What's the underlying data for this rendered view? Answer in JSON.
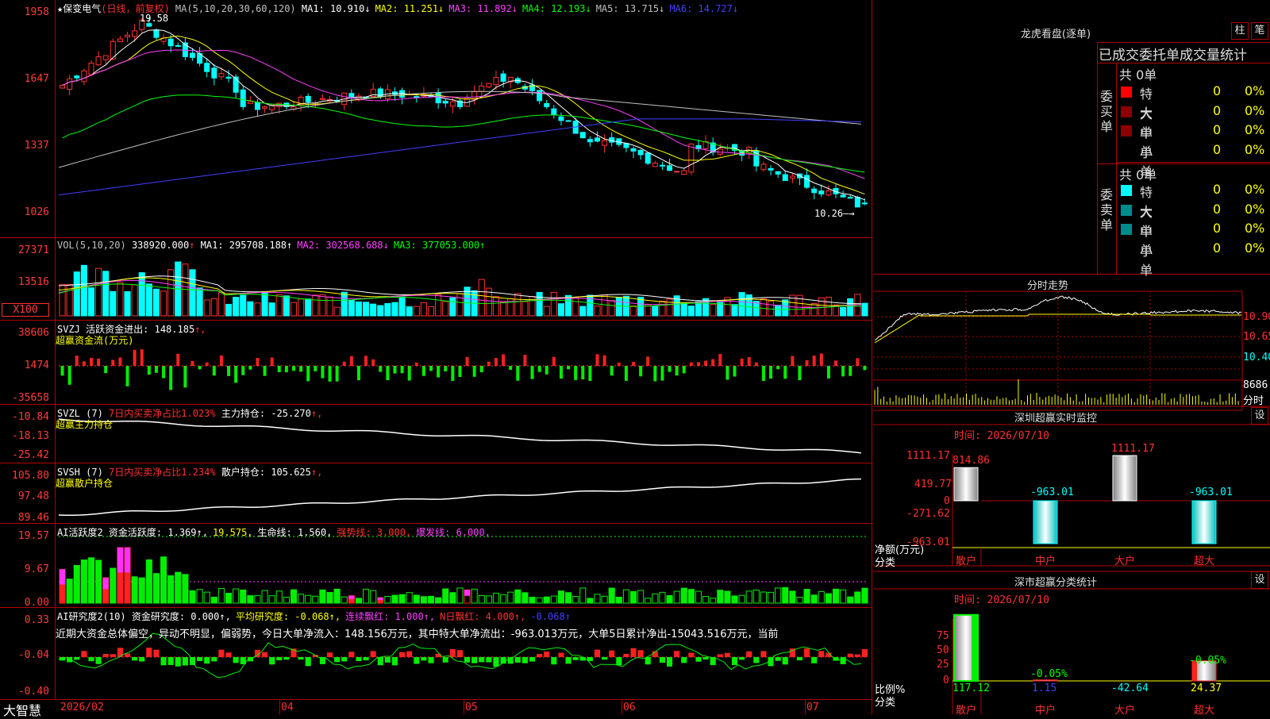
{
  "app": {
    "name": "大智慧"
  },
  "stock": {
    "name": "★保变电气",
    "mode": "(日线，前复权)",
    "high_label": "19.58",
    "last_label": "10.26"
  },
  "main_panel": {
    "ma_header": "MA(5,10,20,30,60,120)",
    "ma": [
      {
        "label": "MA1:",
        "value": "10.910",
        "arrow": "↓",
        "color": "#ffffff"
      },
      {
        "label": "MA2:",
        "value": "11.251",
        "arrow": "↓",
        "color": "#ffff00"
      },
      {
        "label": "MA3:",
        "value": "11.892",
        "arrow": "↓",
        "color": "#ff40ff"
      },
      {
        "label": "MA4:",
        "value": "12.193",
        "arrow": "↓",
        "color": "#00ff00"
      },
      {
        "label": "MA5:",
        "value": "13.715",
        "arrow": "↓",
        "color": "#c0c0c0"
      },
      {
        "label": "MA6:",
        "value": "14.727",
        "arrow": "↓",
        "color": "#4040ff"
      }
    ],
    "y_labels": [
      "1958",
      "1647",
      "1337",
      "1026"
    ]
  },
  "vol_panel": {
    "header": "VOL(5,10,20)",
    "value": "338920.000",
    "arrow": "↑",
    "ma": [
      {
        "label": "MA1:",
        "value": "295708.188",
        "arrow": "↑",
        "color": "#ffffff"
      },
      {
        "label": "MA2:",
        "value": "302568.688",
        "arrow": "↓",
        "color": "#ff40ff"
      },
      {
        "label": "MA3:",
        "value": "377053.000",
        "arrow": "↑",
        "color": "#00ff00"
      }
    ],
    "y_labels": [
      "27371",
      "13516",
      "X100"
    ]
  },
  "svzj_panel": {
    "header": "SVZJ",
    "label": "活跃资金进出:",
    "value": "148.185",
    "arrow": "↑,",
    "subtitle": "超赢资金流(万元)",
    "y_labels": [
      "38606",
      "1474",
      "-35658"
    ]
  },
  "svzl_panel": {
    "header": "SVZL (7)",
    "ratio": "7日内买卖净占比1.023%",
    "label": "主力持仓:",
    "value": "-25.270",
    "arrow": "↑,",
    "subtitle": "超赢主力持仓",
    "y_labels": [
      "-10.84",
      "-18.13",
      "-25.42"
    ]
  },
  "svsh_panel": {
    "header": "SVSH (7)",
    "ratio": "7日内买卖净占比1.234%",
    "label": "散户持仓:",
    "value": "105.625",
    "arrow": "↑,",
    "subtitle": "超赢散户持仓",
    "y_labels": [
      "105.80",
      "97.48",
      "89.46"
    ]
  },
  "ai1_panel": {
    "header": "AI活跃度2",
    "items": [
      {
        "text": "资金活跃度: 1.369",
        "arrow": "↑,",
        "color": "#ffffff"
      },
      {
        "text": "19.575,",
        "arrow": "",
        "color": "#ffff00"
      },
      {
        "text": "生命线: 1.560,",
        "arrow": "",
        "color": "#ffffff"
      },
      {
        "text": "强势线: 3.000,",
        "arrow": "",
        "color": "#ff3030"
      },
      {
        "text": "爆发线: 6.000,",
        "arrow": "",
        "color": "#ff40ff"
      }
    ],
    "y_labels": [
      "19.57",
      "9.67",
      "0.00"
    ]
  },
  "ai2_panel": {
    "header": "AI研究度2(10)",
    "items": [
      {
        "text": "资金研究度: 0.000",
        "arrow": "↑,",
        "color": "#ffffff"
      },
      {
        "text": "平均研究度: -0.068",
        "arrow": "↑,",
        "color": "#ffff00"
      },
      {
        "text": "连续飘红: 1.000",
        "arrow": "↑,",
        "color": "#ff40ff"
      },
      {
        "text": "N日飘红: 4.000",
        "arrow": "↑,",
        "color": "#ff3030"
      },
      {
        "text": "-0.068",
        "arrow": "↑",
        "color": "#4040ff"
      }
    ],
    "comment": "近期大资金总体偏空，异动不明显，偏弱势，今日大单净流入：148.156万元，其中特大单净流出：-963.013万元，大单5日累计净出-15043.516万元，当前",
    "y_labels": [
      "0.33",
      "-0.04",
      "-0.40"
    ]
  },
  "x_axis": {
    "labels": [
      "2026/02",
      "04",
      "05",
      "06",
      "07"
    ]
  },
  "dragon": {
    "title": "龙虎看盘(逐单)",
    "btn1": "柱",
    "btn2": "笔",
    "tabs": "已成交委托单成交量统计",
    "buy": {
      "side": "委买单",
      "total": "共 0单",
      "rows": [
        {
          "name": "特大",
          "count": "0",
          "pct": "0%"
        },
        {
          "name": "大单",
          "count": "0",
          "pct": "0%"
        },
        {
          "name": "中单",
          "count": "0",
          "pct": "0%"
        },
        {
          "name": "小单",
          "count": "0",
          "pct": "0%"
        }
      ]
    },
    "sell": {
      "side": "委卖单",
      "total": "共 0单",
      "rows": [
        {
          "name": "特大",
          "count": "0",
          "pct": "0%"
        },
        {
          "name": "大单",
          "count": "0",
          "pct": "0%"
        },
        {
          "name": "中单",
          "count": "0",
          "pct": "0%"
        },
        {
          "name": "小单",
          "count": "0",
          "pct": "0%"
        }
      ]
    }
  },
  "intraday": {
    "title": "分时走势",
    "y_labels": [
      "10.90",
      "10.65",
      "10.40"
    ],
    "vol_label": "8686",
    "unit_label": "分时"
  },
  "monitor": {
    "title": "深圳超赢实时监控",
    "btn": "设",
    "time": "时间: 2026/07/10",
    "y_labels": [
      "1111.17",
      "419.77",
      "0",
      "-271.62",
      "-963.01"
    ],
    "axis_title": "净额(万元)",
    "axis_sub": "分类"
  },
  "classify": {
    "title": "深市超赢分类统计",
    "btn": "设",
    "time": "时间: 2026/07/10",
    "y_labels": [
      "75",
      "50",
      "25",
      "0"
    ],
    "axis_title": "比例%",
    "axis_sub": "分类"
  },
  "chart_data": [
    {
      "type": "bar",
      "title": "深圳超赢实时监控",
      "categories": [
        "散户",
        "中户",
        "大户",
        "超大"
      ],
      "values": [
        814.86,
        -963.01,
        1111.17,
        -963.01
      ],
      "ylim": [
        -963.01,
        1111.17
      ],
      "ylabel": "净额(万元)",
      "xlabel": "分类"
    },
    {
      "type": "bar",
      "title": "深市超赢分类统计",
      "categories": [
        "散户",
        "中户",
        "大户",
        "超大"
      ],
      "values": [
        117.12,
        1.15,
        -42.64,
        24.37
      ],
      "top_labels": [
        "",
        "-0.05%",
        "",
        "-0.05%"
      ],
      "ylim": [
        0,
        75
      ],
      "ylabel": "比例%",
      "xlabel": "分类"
    },
    {
      "type": "line",
      "title": "",
      "series": [
        {
          "name": "MA1",
          "values": [
            10.91
          ]
        },
        {
          "name": "MA2",
          "values": [
            11.251
          ]
        },
        {
          "name": "MA3",
          "values": [
            11.892
          ]
        },
        {
          "name": "MA4",
          "values": [
            12.193
          ]
        },
        {
          "name": "MA5",
          "values": [
            13.715
          ]
        },
        {
          "name": "MA6",
          "values": [
            14.727
          ]
        }
      ],
      "ylim": [
        10.26,
        19.58
      ]
    }
  ]
}
